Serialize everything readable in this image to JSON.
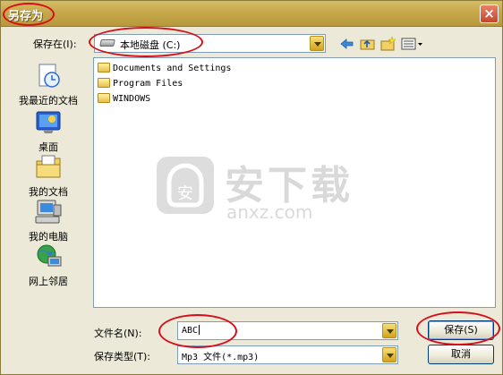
{
  "dialog": {
    "title": "另存为",
    "close_symbol": "×"
  },
  "toolbar": {
    "look_in_label": "保存在(I):",
    "look_in_value": "本地磁盘 (C:)",
    "icons": [
      "back-arrow-icon",
      "up-folder-icon",
      "new-folder-icon",
      "view-menu-icon"
    ]
  },
  "places": [
    {
      "label": "我最近的文档",
      "icon": "recent-documents-icon"
    },
    {
      "label": "桌面",
      "icon": "desktop-icon"
    },
    {
      "label": "我的文档",
      "icon": "my-documents-icon"
    },
    {
      "label": "我的电脑",
      "icon": "my-computer-icon"
    },
    {
      "label": "网上邻居",
      "icon": "network-places-icon"
    }
  ],
  "files": [
    {
      "name": "Documents and Settings",
      "icon": "folder-icon"
    },
    {
      "name": "Program Files",
      "icon": "folder-icon"
    },
    {
      "name": "WINDOWS",
      "icon": "folder-icon"
    }
  ],
  "watermark": {
    "text": "安下载",
    "sub": "anxz.com",
    "logo_char": "安"
  },
  "filename": {
    "label": "文件名(N):",
    "value": "ABC"
  },
  "filetype": {
    "label": "保存类型(T):",
    "value": "Mp3 文件(*.mp3)"
  },
  "buttons": {
    "save": "保存(S)",
    "cancel": "取消"
  },
  "colors": {
    "titlebar": "#c6a84a",
    "annotation": "#d6101a",
    "dialog_bg": "#ece9d8"
  }
}
